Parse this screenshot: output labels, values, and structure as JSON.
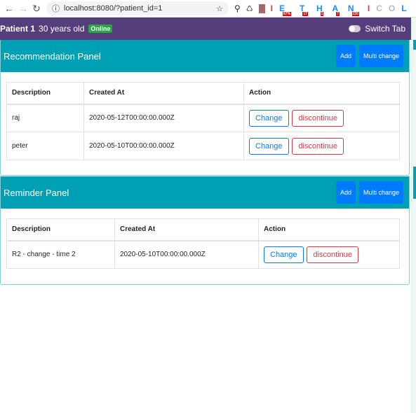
{
  "browser": {
    "url": "localhost:8080/?patient_id=1",
    "extensions": [
      {
        "letter": "I",
        "badge": ""
      },
      {
        "letter": "E",
        "badge": "67%"
      },
      {
        "letter": "T",
        "badge": "17"
      },
      {
        "letter": "H",
        "badge": "1"
      },
      {
        "letter": "A",
        "badge": "7"
      },
      {
        "letter": "N",
        "badge": "220"
      },
      {
        "letter": "I",
        "badge": ""
      },
      {
        "letter": "C",
        "badge": ""
      },
      {
        "letter": "O",
        "badge": ""
      },
      {
        "letter": "L",
        "badge": ""
      }
    ]
  },
  "header": {
    "patient": "Patient 1",
    "age": "30 years old",
    "status": "Online",
    "switch_label": "Switch Tab",
    "switch_on": false
  },
  "colors": {
    "header": "#563d7c",
    "panel": "#00a0b4",
    "primary": "#007bff",
    "danger": "#dc3545",
    "success": "#28a745"
  },
  "recommendation": {
    "title": "Recommendation Panel",
    "add": "Add",
    "multi": "Multi change",
    "columns": [
      "Description",
      "Created At",
      "Action"
    ],
    "rows": [
      {
        "description": "raj",
        "created": "2020-05-12T00:00:00.000Z",
        "change": "Change",
        "discontinue": "discontinue"
      },
      {
        "description": "peter",
        "created": "2020-05-10T00:00:00.000Z",
        "change": "Change",
        "discontinue": "discontinue"
      }
    ]
  },
  "reminder": {
    "title": "Reminder Panel",
    "add": "Add",
    "multi": "Multi change",
    "columns": [
      "Description",
      "Created At",
      "Action"
    ],
    "rows": [
      {
        "description": "R2 - change - time 2",
        "created": "2020-05-10T00:00:00.000Z",
        "change": "Change",
        "discontinue": "discontinue"
      }
    ]
  }
}
